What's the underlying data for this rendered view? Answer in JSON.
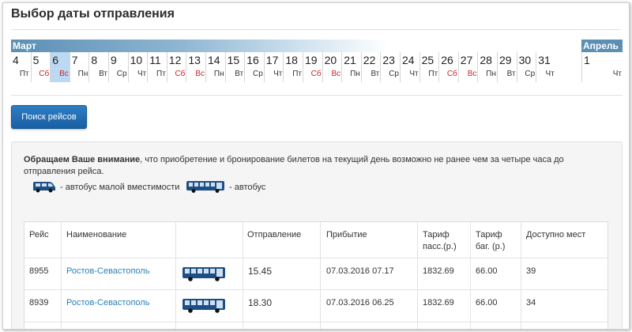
{
  "page": {
    "title": "Выбор даты отправления"
  },
  "calendar": {
    "months": [
      "Март",
      "Апрель"
    ],
    "selected_day": "6",
    "days": [
      {
        "num": "4",
        "name": "Пт",
        "weekend": false
      },
      {
        "num": "5",
        "name": "Сб",
        "weekend": true
      },
      {
        "num": "6",
        "name": "Вс",
        "weekend": true
      },
      {
        "num": "7",
        "name": "Пн",
        "weekend": false
      },
      {
        "num": "8",
        "name": "Вт",
        "weekend": false
      },
      {
        "num": "9",
        "name": "Ср",
        "weekend": false
      },
      {
        "num": "10",
        "name": "Чт",
        "weekend": false
      },
      {
        "num": "11",
        "name": "Пт",
        "weekend": false
      },
      {
        "num": "12",
        "name": "Сб",
        "weekend": true
      },
      {
        "num": "13",
        "name": "Вс",
        "weekend": true
      },
      {
        "num": "14",
        "name": "Пн",
        "weekend": false
      },
      {
        "num": "15",
        "name": "Вт",
        "weekend": false
      },
      {
        "num": "16",
        "name": "Ср",
        "weekend": false
      },
      {
        "num": "17",
        "name": "Чт",
        "weekend": false
      },
      {
        "num": "18",
        "name": "Пт",
        "weekend": false
      },
      {
        "num": "19",
        "name": "Сб",
        "weekend": true
      },
      {
        "num": "20",
        "name": "Вс",
        "weekend": true
      },
      {
        "num": "21",
        "name": "Пн",
        "weekend": false
      },
      {
        "num": "22",
        "name": "Вт",
        "weekend": false
      },
      {
        "num": "23",
        "name": "Ср",
        "weekend": false
      },
      {
        "num": "24",
        "name": "Чт",
        "weekend": false
      },
      {
        "num": "25",
        "name": "Пт",
        "weekend": false
      },
      {
        "num": "26",
        "name": "Сб",
        "weekend": true
      },
      {
        "num": "27",
        "name": "Вс",
        "weekend": true
      },
      {
        "num": "28",
        "name": "Пн",
        "weekend": false
      },
      {
        "num": "29",
        "name": "Вт",
        "weekend": false
      },
      {
        "num": "30",
        "name": "Ср",
        "weekend": false
      },
      {
        "num": "31",
        "name": "Чт",
        "weekend": false
      },
      {
        "num": "1",
        "name": "Чт",
        "weekend": false
      }
    ]
  },
  "search_button": {
    "label": "Поиск рейсов"
  },
  "notice": {
    "bold": "Обращаем Ваше внимание",
    "text": ", что приобретение и бронирование билетов на текущий день возможно не ранее чем за четыре часа до отправления рейса."
  },
  "legend": {
    "small_bus": "- автобус малой вместимости",
    "bus": "- автобус"
  },
  "table": {
    "headers": {
      "trip": "Рейс",
      "name": "Наименование",
      "icon": "",
      "departure": "Отправление",
      "arrival": "Прибытие",
      "tariff_pass_1": "Тариф",
      "tariff_pass_2": "пасс.(р.)",
      "tariff_bag_1": "Тариф",
      "tariff_bag_2": "баг. (р.)",
      "seats": "Доступно мест"
    },
    "rows": [
      {
        "trip": "8955",
        "name": "Ростов-Севастополь",
        "departure": "15.45",
        "arrival": "07.03.2016 07.17",
        "tariff_pass": "1832.69",
        "tariff_bag": "66.00",
        "seats": "39"
      },
      {
        "trip": "8939",
        "name": "Ростов-Севастополь",
        "departure": "18.30",
        "arrival": "07.03.2016 06.25",
        "tariff_pass": "1832.69",
        "tariff_bag": "66.00",
        "seats": "34"
      }
    ]
  },
  "colors": {
    "accent": "#1a5fa3",
    "month_bar": "#5b8fb4",
    "weekend": "#c9252b",
    "link": "#2a82b8",
    "selected": "#bcd9f3"
  }
}
